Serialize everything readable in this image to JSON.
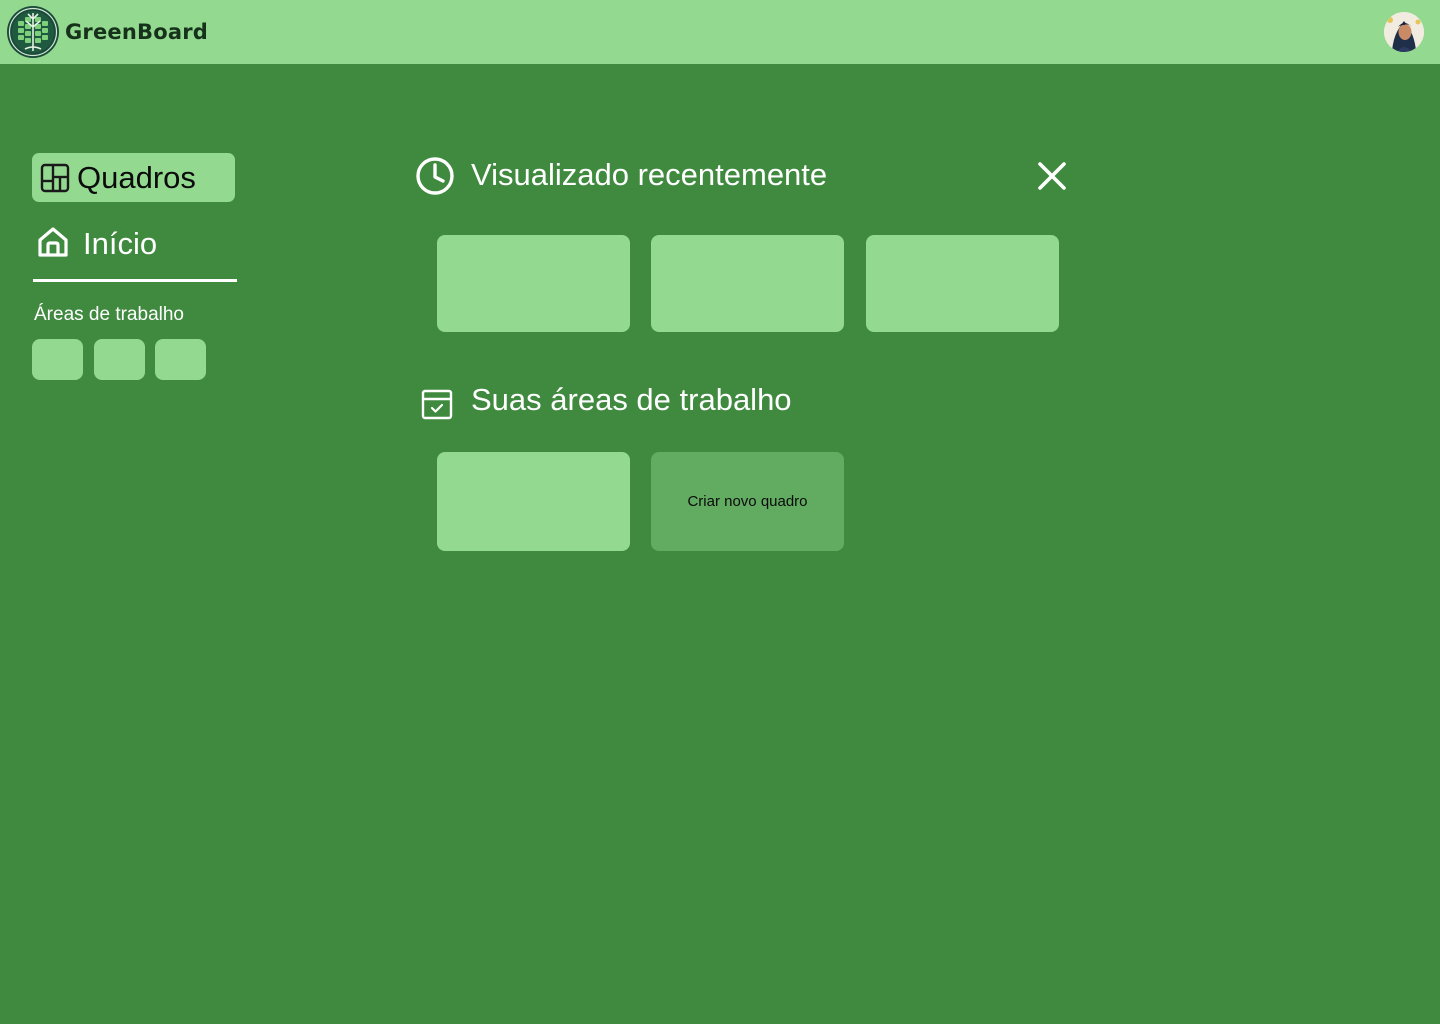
{
  "header": {
    "brand_name": "GreenBoard",
    "logo_icon": "tree-circuit-logo",
    "avatar_icon": "user-avatar"
  },
  "sidebar": {
    "boards_label": "Quadros",
    "boards_icon": "board-layout-icon",
    "home_label": "Início",
    "home_icon": "home-icon",
    "workspaces_heading": "Áreas de trabalho",
    "workspace_chips": [
      "",
      "",
      ""
    ]
  },
  "recent": {
    "title": "Visualizado recentemente",
    "icon": "clock-icon",
    "close_icon": "close-icon",
    "cards": [
      "",
      "",
      ""
    ]
  },
  "workspaces": {
    "title": "Suas áreas de trabalho",
    "icon": "calendar-check-icon",
    "cards": [
      ""
    ],
    "new_board_label": "Criar novo quadro"
  },
  "colors": {
    "background": "#3f8a3f",
    "topbar": "#93da90",
    "card": "#93da90",
    "card_new": "#62ac62",
    "text_light": "#ffffff",
    "text_dark": "#0b0b0b"
  }
}
